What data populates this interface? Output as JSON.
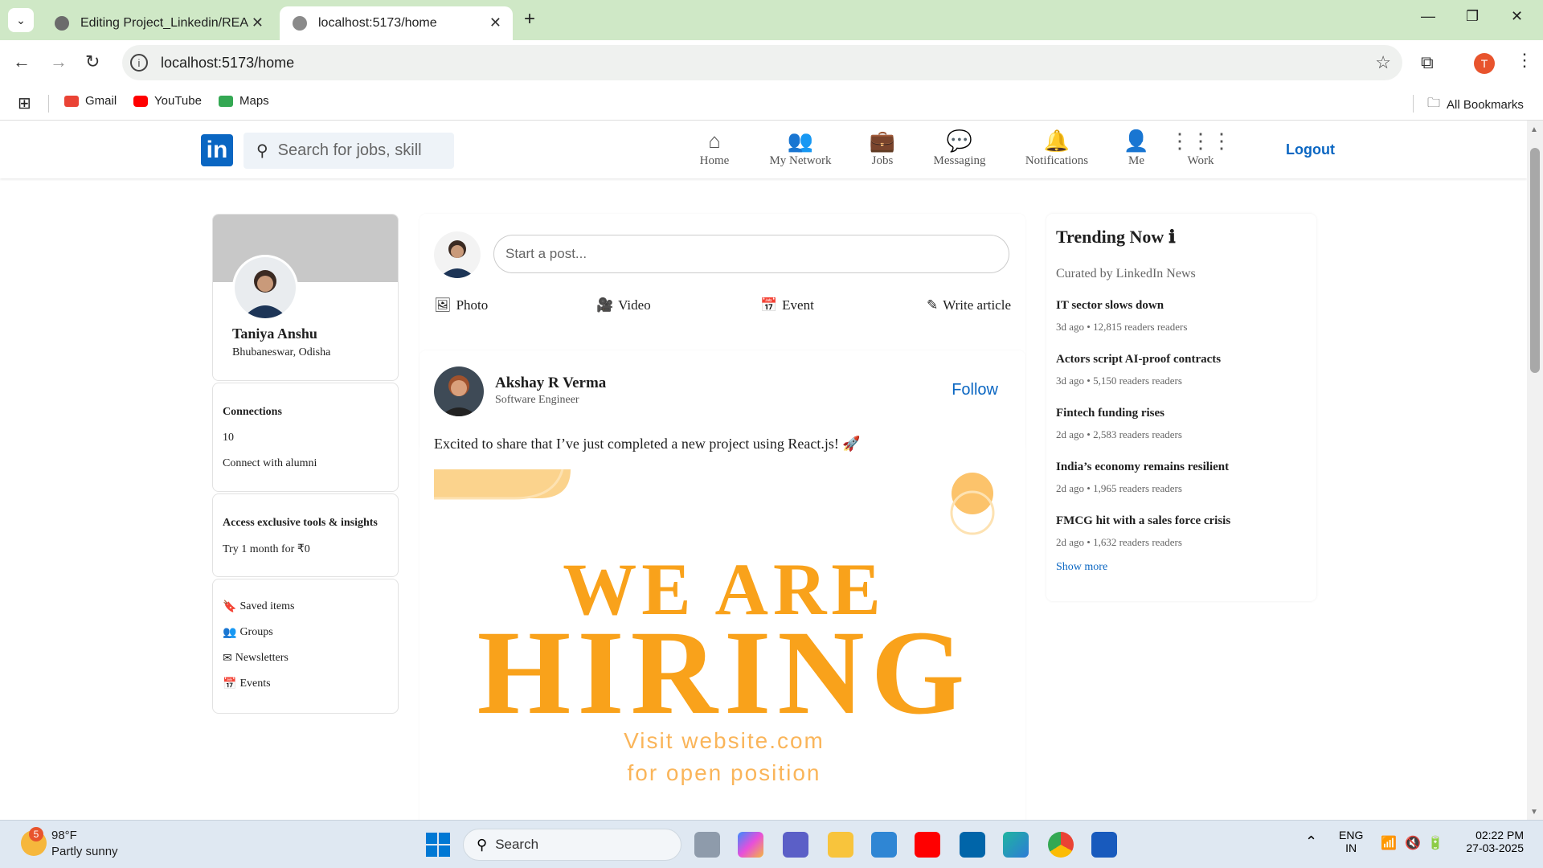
{
  "browser": {
    "tabs": [
      {
        "title": "Editing Project_Linkedin/READM"
      },
      {
        "title": "localhost:5173/home"
      }
    ],
    "url": "localhost:5173/home",
    "profile_initial": "T",
    "bookmarks": [
      {
        "label": "Gmail"
      },
      {
        "label": "YouTube"
      },
      {
        "label": "Maps"
      }
    ],
    "all_bookmarks": "All Bookmarks"
  },
  "header": {
    "search_placeholder": "Search for jobs, skill",
    "nav": [
      {
        "label": "Home",
        "icon": "home-icon"
      },
      {
        "label": "My Network",
        "icon": "network-icon"
      },
      {
        "label": "Jobs",
        "icon": "briefcase-icon"
      },
      {
        "label": "Messaging",
        "icon": "message-icon"
      },
      {
        "label": "Notifications",
        "icon": "bell-icon"
      },
      {
        "label": "Me",
        "icon": "user-icon"
      },
      {
        "label": "Work",
        "icon": "grid-icon"
      }
    ],
    "logout": "Logout"
  },
  "profile": {
    "name": "Taniya Anshu",
    "location": "Bhubaneswar, Odisha",
    "connections_label": "Connections",
    "connections_count": "10",
    "connect_alumni": "Connect with alumni",
    "premium_title": "Access exclusive tools & insights",
    "premium_offer": "Try 1 month for ₹0",
    "links": [
      {
        "label": "Saved items",
        "icon": "bookmark-icon"
      },
      {
        "label": "Groups",
        "icon": "groups-icon"
      },
      {
        "label": "Newsletters",
        "icon": "envelope-icon"
      },
      {
        "label": "Events",
        "icon": "calendar-icon"
      }
    ]
  },
  "composer": {
    "placeholder": "Start a post...",
    "actions": [
      {
        "label": "Photo",
        "icon": "image-icon"
      },
      {
        "label": "Video",
        "icon": "video-icon"
      },
      {
        "label": "Event",
        "icon": "calendar-icon"
      },
      {
        "label": "Write article",
        "icon": "pencil-icon"
      }
    ]
  },
  "post": {
    "author": "Akshay R Verma",
    "headline": "Software Engineer",
    "follow": "Follow",
    "text": "Excited to share that I’ve just completed a new project using React.js! 🚀",
    "image": {
      "line1": "WE ARE",
      "line2": "HIRING",
      "line3": "Visit website.com",
      "line4": "for open position"
    }
  },
  "trending": {
    "title": "Trending Now",
    "subtitle": "Curated by LinkedIn News",
    "items": [
      {
        "headline": "IT sector slows down",
        "meta": "3d ago • 12,815 readers readers"
      },
      {
        "headline": "Actors script AI-proof contracts",
        "meta": "3d ago • 5,150 readers readers"
      },
      {
        "headline": "Fintech funding rises",
        "meta": "2d ago • 2,583 readers readers"
      },
      {
        "headline": "India’s economy remains resilient",
        "meta": "2d ago • 1,965 readers readers"
      },
      {
        "headline": "FMCG hit with a sales force crisis",
        "meta": "2d ago • 1,632 readers readers"
      }
    ],
    "show_more": "Show more"
  },
  "taskbar": {
    "weather_badge": "5",
    "temperature": "98°F",
    "condition": "Partly sunny",
    "search": "Search",
    "lang1": "ENG",
    "lang2": "IN",
    "time": "02:22 PM",
    "date": "27-03-2025"
  },
  "colors": {
    "linkedin_blue": "#0a66c2",
    "hiring_orange": "#f9a21b",
    "chrome_tab_bg": "#cfe8c6"
  }
}
